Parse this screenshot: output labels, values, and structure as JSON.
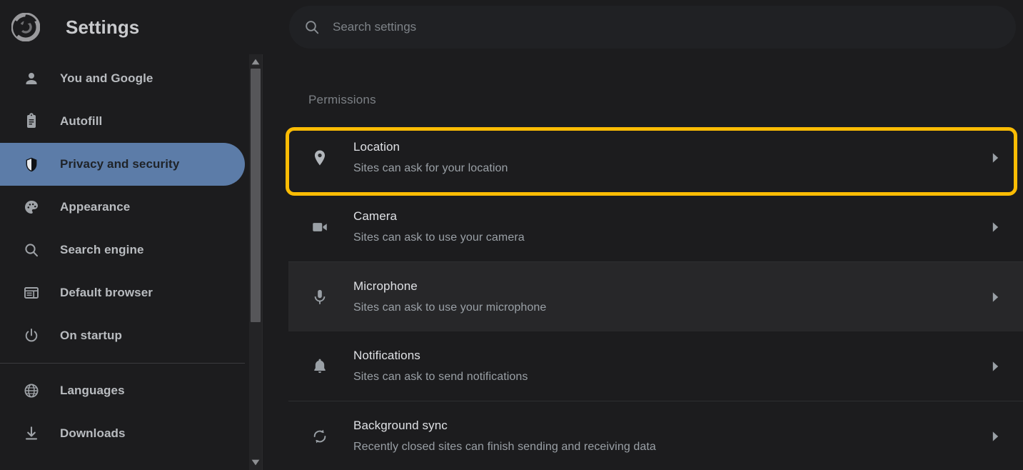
{
  "header": {
    "logo_icon": "chrome-logo-icon",
    "title": "Settings",
    "search": {
      "icon": "search-icon",
      "placeholder": "Search settings",
      "value": ""
    }
  },
  "sidebar": {
    "scrollbar": {
      "up_icon": "scroll-up-arrow-icon",
      "down_icon": "scroll-down-arrow-icon"
    },
    "items": [
      {
        "label": "You and Google",
        "icon": "person-icon",
        "selected": false
      },
      {
        "label": "Autofill",
        "icon": "clipboard-icon",
        "selected": false
      },
      {
        "label": "Privacy and security",
        "icon": "shield-icon",
        "selected": true
      },
      {
        "label": "Appearance",
        "icon": "palette-icon",
        "selected": false
      },
      {
        "label": "Search engine",
        "icon": "magnifier-icon",
        "selected": false
      },
      {
        "label": "Default browser",
        "icon": "browser-window-icon",
        "selected": false
      },
      {
        "label": "On startup",
        "icon": "power-icon",
        "selected": false
      },
      {
        "label": "Languages",
        "icon": "globe-icon",
        "selected": false
      },
      {
        "label": "Downloads",
        "icon": "download-icon",
        "selected": false
      }
    ],
    "divider_after_index": 6
  },
  "content": {
    "section_title": "Permissions",
    "rows": [
      {
        "title": "Location",
        "subtitle": "Sites can ask for your location",
        "icon": "location-pin-icon",
        "arrow_icon": "chevron-right-icon",
        "highlighted": true,
        "hovered": false
      },
      {
        "title": "Camera",
        "subtitle": "Sites can ask to use your camera",
        "icon": "video-camera-icon",
        "arrow_icon": "chevron-right-icon",
        "highlighted": false,
        "hovered": false
      },
      {
        "title": "Microphone",
        "subtitle": "Sites can ask to use your microphone",
        "icon": "microphone-icon",
        "arrow_icon": "chevron-right-icon",
        "highlighted": false,
        "hovered": true
      },
      {
        "title": "Notifications",
        "subtitle": "Sites can ask to send notifications",
        "icon": "bell-icon",
        "arrow_icon": "chevron-right-icon",
        "highlighted": false,
        "hovered": false
      },
      {
        "title": "Background sync",
        "subtitle": "Recently closed sites can finish sending and receiving data",
        "icon": "sync-icon",
        "arrow_icon": "chevron-right-icon",
        "highlighted": false,
        "hovered": false
      }
    ]
  },
  "colors": {
    "page_background": "#1c1c1e",
    "search_background": "#202124",
    "selected_nav": "#5c7ca8",
    "highlight_ring": "#fbbc04",
    "row_hover": "#272729",
    "text_primary": "#dfe1e5",
    "text_secondary": "#9aa0a6"
  }
}
